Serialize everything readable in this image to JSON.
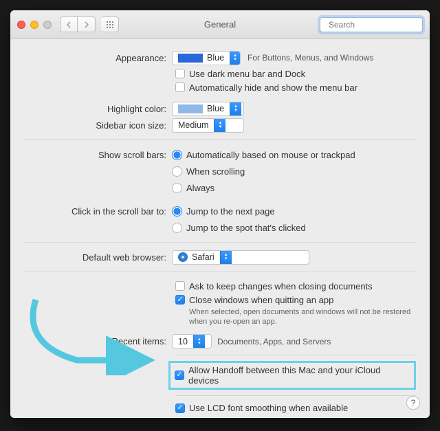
{
  "window": {
    "title": "General"
  },
  "toolbar": {
    "search_placeholder": "Search"
  },
  "appearance": {
    "label": "Appearance:",
    "value": "Blue",
    "hint": "For Buttons, Menus, and Windows",
    "dark_menu": "Use dark menu bar and Dock",
    "auto_hide": "Automatically hide and show the menu bar"
  },
  "highlight": {
    "label": "Highlight color:",
    "value": "Blue"
  },
  "sidebar": {
    "label": "Sidebar icon size:",
    "value": "Medium"
  },
  "scroll": {
    "label": "Show scroll bars:",
    "options": [
      "Automatically based on mouse or trackpad",
      "When scrolling",
      "Always"
    ],
    "selected": 0
  },
  "click_scroll": {
    "label": "Click in the scroll bar to:",
    "options": [
      "Jump to the next page",
      "Jump to the spot that's clicked"
    ],
    "selected": 0
  },
  "browser": {
    "label": "Default web browser:",
    "value": "Safari"
  },
  "documents": {
    "ask_keep": "Ask to keep changes when closing documents",
    "close_windows": "Close windows when quitting an app",
    "close_note": "When selected, open documents and windows will not be restored when you re-open an app."
  },
  "recent": {
    "label": "Recent items:",
    "value": "10",
    "suffix": "Documents, Apps, and Servers"
  },
  "handoff": {
    "label": "Allow Handoff between this Mac and your iCloud devices"
  },
  "lcd": {
    "label": "Use LCD font smoothing when available"
  },
  "help": "?",
  "colors": {
    "accent": "#1f7fe8",
    "annotation": "#55c8e0"
  }
}
